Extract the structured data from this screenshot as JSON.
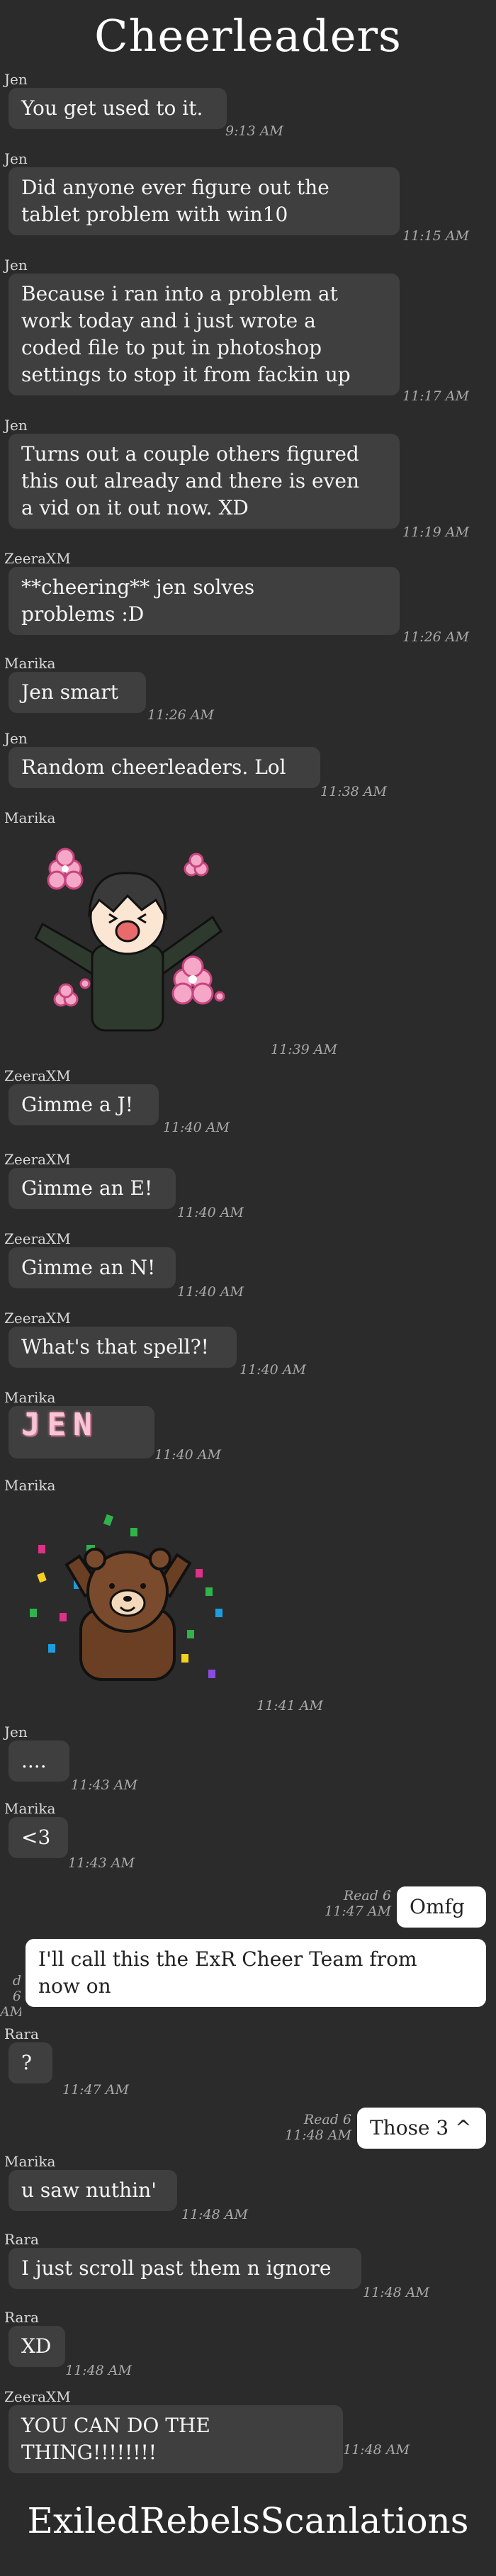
{
  "header": {
    "title": "Cheerleaders"
  },
  "footer": {
    "credit": "ExiledRebelsScanlations"
  },
  "messages": [
    {
      "sender": "Jen",
      "text": "You get used to it.",
      "time": "9:13 AM"
    },
    {
      "sender": "Jen",
      "lines": [
        "Did anyone ever figure out the",
        "tablet problem with win10"
      ],
      "time": "11:15 AM"
    },
    {
      "sender": "Jen",
      "lines": [
        "Because i ran into a problem at",
        "work today and i just wrote a",
        "coded file to put in photoshop",
        "settings to stop it from fackin up"
      ],
      "time": "11:17 AM"
    },
    {
      "sender": "Jen",
      "lines": [
        "Turns out a couple others figured",
        "this out already and there is even",
        "a vid on it out now. XD"
      ],
      "time": "11:19 AM"
    },
    {
      "sender": "ZeeraXM",
      "lines": [
        "**cheering** jen solves",
        "problems :D"
      ],
      "time": "11:26 AM"
    },
    {
      "sender": "Marika",
      "text": "Jen smart",
      "time": "11:26 AM"
    },
    {
      "sender": "Jen",
      "text": "Random cheerleaders. Lol",
      "time": "11:38 AM"
    },
    {
      "sender": "Marika",
      "sticker": "cheering-girl-sticker",
      "time": "11:39 AM"
    },
    {
      "sender": "ZeeraXM",
      "text": "Gimme a J!",
      "time": "11:40 AM"
    },
    {
      "sender": "ZeeraXM",
      "text": "Gimme an E!",
      "time": "11:40 AM"
    },
    {
      "sender": "ZeeraXM",
      "text": "Gimme an N!",
      "time": "11:40 AM"
    },
    {
      "sender": "ZeeraXM",
      "text": "What's that spell?!",
      "time": "11:40 AM"
    },
    {
      "sender": "Marika",
      "text": "JEN",
      "time": "11:40 AM"
    },
    {
      "sender": "Marika",
      "sticker": "confetti-bear-sticker",
      "time": "11:41 AM"
    },
    {
      "sender": "Jen",
      "text": "....",
      "time": "11:43 AM"
    },
    {
      "sender": "Marika",
      "text": "<3",
      "time": "11:43 AM"
    },
    {
      "own": true,
      "text": "Omfg",
      "read": "Read 6",
      "time": "11:47 AM"
    },
    {
      "own": true,
      "lines": [
        "I'll call this the ExR Cheer Team from",
        "now on"
      ],
      "read": "d 6",
      "time": "AM"
    },
    {
      "sender": "Rara",
      "text": "?",
      "time": "11:47 AM"
    },
    {
      "own": true,
      "text": "Those 3 ^",
      "read": "Read 6",
      "time": "11:48 AM"
    },
    {
      "sender": "Marika",
      "text": "u saw nuthin'",
      "time": "11:48 AM"
    },
    {
      "sender": "Rara",
      "text": "I just scroll past them n ignore",
      "time": "11:48 AM"
    },
    {
      "sender": "Rara",
      "text": "XD",
      "time": "11:48 AM"
    },
    {
      "sender": "ZeeraXM",
      "text": "YOU CAN DO THE THING!!!!!!!!",
      "time": "11:48 AM"
    }
  ],
  "colors": {
    "background": "#2b2b2b",
    "bubble": "#3f3f3f",
    "own_bubble": "#ffffff",
    "text": "#f5f5f5"
  }
}
